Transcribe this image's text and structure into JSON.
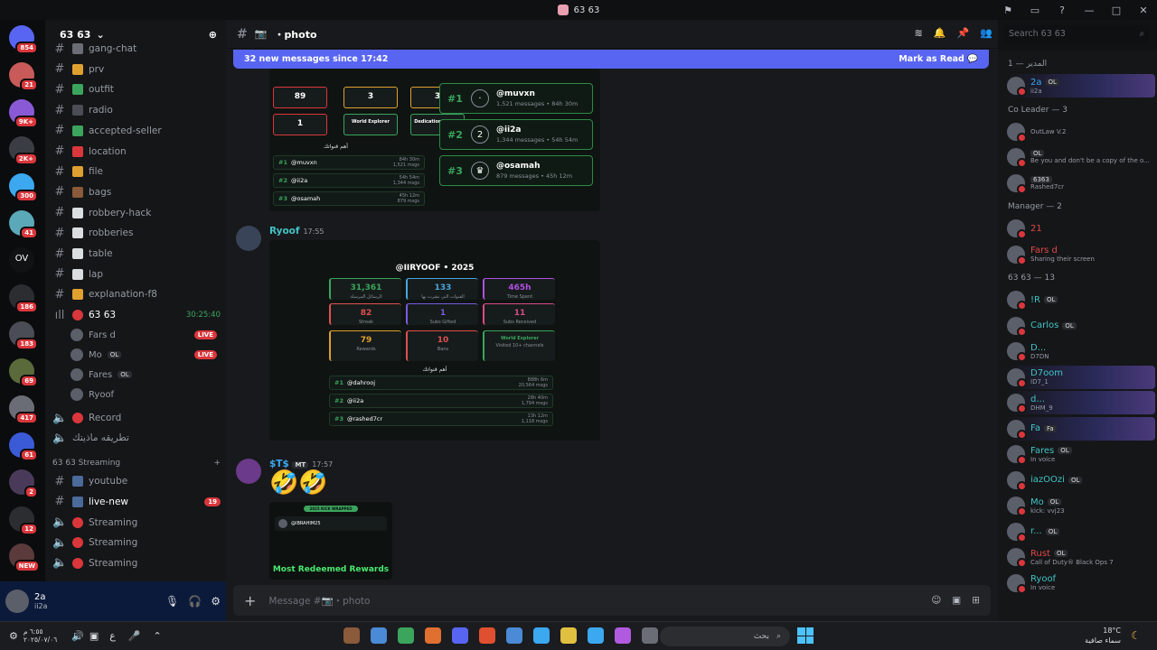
{
  "window": {
    "title": "63 63"
  },
  "server": {
    "name": "63 63"
  },
  "server_badges": [
    "854",
    "21",
    "9K+",
    "2K+",
    "300",
    "41",
    "OV",
    "186",
    "183",
    "69",
    "417",
    "61",
    "2",
    "12",
    "NEW"
  ],
  "channels": [
    {
      "name": "gang-chat",
      "icon": "hash"
    },
    {
      "name": "prv",
      "icon": "hash"
    },
    {
      "name": "outfit",
      "icon": "hash"
    },
    {
      "name": "radio",
      "icon": "hash"
    },
    {
      "name": "accepted-seller",
      "icon": "hash"
    },
    {
      "name": "location",
      "icon": "hash"
    },
    {
      "name": "file",
      "icon": "hash"
    },
    {
      "name": "bags",
      "icon": "hash"
    },
    {
      "name": "robbery-hack",
      "icon": "hash"
    },
    {
      "name": "robberies",
      "icon": "hash"
    },
    {
      "name": "table",
      "icon": "hash"
    },
    {
      "name": "lap",
      "icon": "hash"
    },
    {
      "name": "explanation-f8",
      "icon": "hash"
    }
  ],
  "voice_channel": {
    "name": "63 63",
    "timer": "30:25:40",
    "users": [
      {
        "name": "Fars d",
        "live": "LIVE"
      },
      {
        "name": "Mo",
        "tag": "OL",
        "live": "LIVE"
      },
      {
        "name": "Fares",
        "tag": "OL"
      },
      {
        "name": "Ryoof"
      }
    ]
  },
  "record_channel": "Record",
  "arabic_channel": "تطريقه ماذيتك",
  "streaming_category": "63 63 Streaming",
  "streaming_channels": [
    {
      "name": "youtube"
    },
    {
      "name": "live-new",
      "badge": "19"
    },
    {
      "name": "Streaming"
    },
    {
      "name": "Streaming"
    },
    {
      "name": "Streaming"
    }
  ],
  "user_panel": {
    "name": "2a",
    "status": "ii2a"
  },
  "header": {
    "channel": "photo"
  },
  "search": {
    "placeholder": "Search 63 63"
  },
  "new_messages": {
    "text": "32 new messages since 17:42",
    "action": "Mark as Read"
  },
  "top_card": {
    "stats": [
      {
        "v": "89"
      },
      {
        "v": "3"
      },
      {
        "v": "3"
      },
      {
        "v": "1"
      }
    ],
    "badges": [
      "World Explorer",
      "Dedication Master"
    ],
    "label": "أهم قنواتك",
    "ranks": [
      {
        "r": "#1",
        "n": "@muvxn",
        "t": "84h 30m",
        "m": "1,521 msgs"
      },
      {
        "r": "#2",
        "n": "@ii2a",
        "t": "54h 54m",
        "m": "1,344 msgs"
      },
      {
        "r": "#3",
        "n": "@osamah",
        "t": "45h 12m",
        "m": "879 msgs"
      }
    ],
    "big_ranks": [
      {
        "r": "#1",
        "n": "@muvxn",
        "s": "1,521 messages • 84h 30m",
        "i": "·"
      },
      {
        "r": "#2",
        "n": "@ii2a",
        "s": "1,344 messages • 54h 54m",
        "i": "2"
      },
      {
        "r": "#3",
        "n": "@osamah",
        "s": "879 messages • 45h 12m",
        "i": "♛"
      }
    ]
  },
  "msg1": {
    "author": "Ryoof",
    "time": "17:55",
    "card": {
      "title": "@IIRYOOF • 2025",
      "stats": [
        {
          "v": "31,361",
          "l": "الرسائل المرسلة",
          "c": "#3ba55d"
        },
        {
          "v": "133",
          "l": "القنوات التي نشرت بها",
          "c": "#4aa3df"
        },
        {
          "v": "465h",
          "l": "Time Spent",
          "c": "#b14fe0"
        },
        {
          "v": "82",
          "l": "Streak",
          "c": "#e05050"
        },
        {
          "v": "1",
          "l": "Subs Gifted",
          "c": "#7a5ae0"
        },
        {
          "v": "11",
          "l": "Subs Received",
          "c": "#d94a8a"
        },
        {
          "v": "79",
          "l": "Rewards",
          "c": "#e0a030"
        },
        {
          "v": "10",
          "l": "Bans",
          "c": "#e05050"
        },
        {
          "v": "World Explorer",
          "l": "Visited 10+ channels",
          "c": "#3ba55d"
        }
      ],
      "label": "أهم قنواتك",
      "ranks": [
        {
          "r": "#1",
          "n": "@dahrooj",
          "t": "888h 6m",
          "m": "20,564 msgs"
        },
        {
          "r": "#2",
          "n": "@ii2a",
          "t": "28h 40m",
          "m": "1,794 msgs"
        },
        {
          "r": "#3",
          "n": "@rashed7cr",
          "t": "13h 12m",
          "m": "1,118 msgs"
        }
      ]
    }
  },
  "msg2": {
    "author": "$T$",
    "tag": "MT",
    "time": "17:57",
    "emoji": "🤣🤣",
    "card": {
      "pill": "2025 KICK WRAPPED",
      "handle": "@IBRAHIM25",
      "heading": "Most Redeemed Rewards"
    }
  },
  "composer": {
    "placeholder": "Message #📷・photo"
  },
  "members": {
    "groups": [
      {
        "title": "المدير — 1",
        "items": [
          {
            "name": "2a",
            "tag": "OL",
            "sub": "ii2a",
            "color": "#3ba8f0"
          }
        ]
      },
      {
        "title": "Co Leader — 3",
        "items": [
          {
            "name": "",
            "sub": "OutLaw V.2",
            "color": "#dbdee1"
          },
          {
            "name": "",
            "tag": "OL",
            "sub": "Be you and don't be a copy of the o...",
            "color": "#dbdee1"
          },
          {
            "name": "",
            "tag": "6363",
            "sub": "Rashed7cr",
            "color": "#dbdee1"
          }
        ]
      },
      {
        "title": "Manager — 2",
        "items": [
          {
            "name": "21",
            "sub": "",
            "color": "#e04848"
          },
          {
            "name": "Fars d",
            "sub": "Sharing their screen",
            "color": "#e04848"
          }
        ]
      },
      {
        "title": "63 63 — 13",
        "items": [
          {
            "name": "!R",
            "tag": "OL",
            "sub": "",
            "color": "#41c3c3"
          },
          {
            "name": "Carlos",
            "tag": "OL",
            "sub": "",
            "color": "#41c3c3"
          },
          {
            "name": "D...",
            "sub": "D7DN",
            "color": "#41c3c3"
          },
          {
            "name": "D7oom",
            "sub": "ID7_1",
            "color": "#41c3c3"
          },
          {
            "name": "d...",
            "sub": "DHM_9",
            "color": "#41c3c3"
          },
          {
            "name": "Fa",
            "tag": "Fa",
            "sub": "",
            "color": "#41c3c3"
          },
          {
            "name": "Fares",
            "tag": "OL",
            "sub": "In voice",
            "color": "#41c3c3"
          },
          {
            "name": "iazOOzi",
            "tag": "OL",
            "sub": "",
            "color": "#41c3c3"
          },
          {
            "name": "Mo",
            "tag": "OL",
            "sub": "kick: vvj23",
            "color": "#41c3c3"
          },
          {
            "name": "r...",
            "tag": "OL",
            "sub": "",
            "color": "#41c3c3"
          },
          {
            "name": "Rust",
            "tag": "OL",
            "sub": "Call of Duty® Black Ops 7",
            "color": "#e04848"
          },
          {
            "name": "Ryoof",
            "sub": "In voice",
            "color": "#41c3c3"
          }
        ]
      }
    ]
  },
  "taskbar": {
    "time": "٦:٥٥ م",
    "date": "٢٠٢٥/٠٧/٠٦",
    "lang": "ع",
    "search": "بحث",
    "temp": "18°C",
    "weather": "سماء صافية"
  }
}
